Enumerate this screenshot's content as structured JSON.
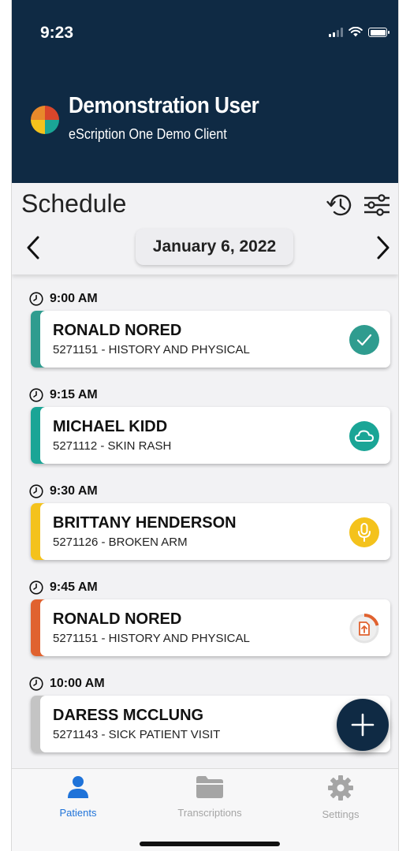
{
  "status_bar": {
    "time": "9:23"
  },
  "user": {
    "name": "Demonstration User",
    "client": "eScription One Demo Client"
  },
  "schedule": {
    "title": "Schedule",
    "date": "January 6, 2022"
  },
  "appointments": [
    {
      "time": "9:00 AM",
      "name": "RONALD NORED",
      "detail": "5271151 - HISTORY AND PHYSICAL",
      "status": "completed",
      "status_icon": "check-icon",
      "stripe_color": "#2f9c8f",
      "icon_color": "#2f9c8f"
    },
    {
      "time": "9:15 AM",
      "name": "MICHAEL KIDD",
      "detail": "5271112 - SKIN RASH",
      "status": "uploaded",
      "status_icon": "cloud-icon",
      "stripe_color": "#1aa596",
      "icon_color": "#1aa596"
    },
    {
      "time": "9:30 AM",
      "name": "BRITTANY HENDERSON",
      "detail": "5271126 - BROKEN ARM",
      "status": "recording",
      "status_icon": "microphone-icon",
      "stripe_color": "#f4c21c",
      "icon_color": "#f4c21c"
    },
    {
      "time": "9:45 AM",
      "name": "RONALD NORED",
      "detail": "5271151 - HISTORY AND PHYSICAL",
      "status": "uploading",
      "status_icon": "upload-progress-icon",
      "stripe_color": "#e0622f",
      "icon_color": "#e0622f"
    },
    {
      "time": "10:00 AM",
      "name": "DARESS MCCLUNG",
      "detail": "5271143 - SICK PATIENT VISIT",
      "status": "pending",
      "status_icon": "",
      "stripe_color": "#c4c4c4",
      "icon_color": "#c4c4c4"
    }
  ],
  "fab": {
    "icon": "plus-icon"
  },
  "nav": {
    "active": "Patients",
    "active_color": "#1f73d9",
    "inactive_color": "#a5a5a5",
    "items": [
      {
        "label": "Patients",
        "icon": "person-icon"
      },
      {
        "label": "Transcriptions",
        "icon": "folder-icon"
      },
      {
        "label": "Settings",
        "icon": "gear-icon"
      }
    ]
  }
}
